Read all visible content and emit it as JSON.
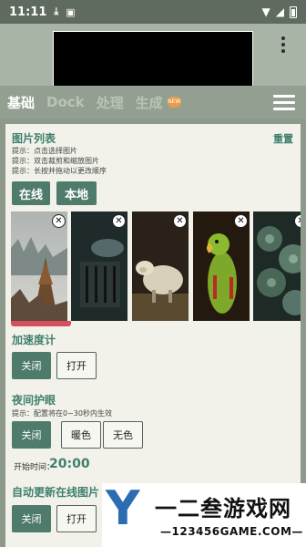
{
  "status_bar": {
    "time": "11:11",
    "icons": [
      "download-icon",
      "photo-icon"
    ],
    "right_icons": [
      "wifi-icon",
      "signal-icon",
      "battery-icon"
    ]
  },
  "tabs": [
    {
      "label": "基础",
      "active": true
    },
    {
      "label": "Dock",
      "active": false
    },
    {
      "label": "处理",
      "active": false
    },
    {
      "label": "生成",
      "active": false,
      "badge": "NEW"
    }
  ],
  "image_list": {
    "title": "图片列表",
    "reset_label": "重置",
    "hints": [
      "提示：点击选择图片",
      "提示：双击裁剪和缩放图片",
      "提示：长按并拖动以更改顺序"
    ],
    "buttons": {
      "online": "在线",
      "local": "本地"
    },
    "images": [
      "misty-forest",
      "dark-gate",
      "sheep",
      "parrot",
      "succulent-plants"
    ],
    "close_glyph": "✕"
  },
  "accelerometer": {
    "title": "加速度计",
    "off": "关闭",
    "on": "打开"
  },
  "night_mode": {
    "title": "夜间护眼",
    "hint": "提示：配置将在0~30秒内生效",
    "off": "关闭",
    "warm": "暖色",
    "none": "无色",
    "start_time_label": "开始时间：",
    "start_time": "20:00"
  },
  "auto_update": {
    "title": "自动更新在线图片",
    "off": "关闭",
    "on": "打开"
  },
  "watermark": {
    "title": "一二叁游戏网",
    "subtitle": "—123456GAME.COM—",
    "brand_letter": "Y"
  },
  "colors": {
    "accent": "#3f7f6e",
    "button_fill": "#4f7b6c",
    "selection": "#d5505c",
    "panel_bg": "#f2f2ea"
  }
}
